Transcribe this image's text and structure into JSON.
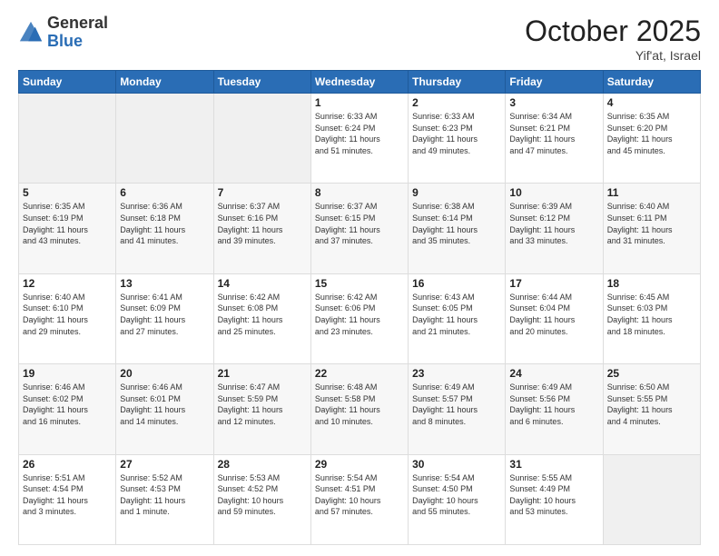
{
  "header": {
    "logo_general": "General",
    "logo_blue": "Blue",
    "month": "October 2025",
    "location": "Yif'at, Israel"
  },
  "weekdays": [
    "Sunday",
    "Monday",
    "Tuesday",
    "Wednesday",
    "Thursday",
    "Friday",
    "Saturday"
  ],
  "weeks": [
    [
      {
        "day": "",
        "info": ""
      },
      {
        "day": "",
        "info": ""
      },
      {
        "day": "",
        "info": ""
      },
      {
        "day": "1",
        "info": "Sunrise: 6:33 AM\nSunset: 6:24 PM\nDaylight: 11 hours\nand 51 minutes."
      },
      {
        "day": "2",
        "info": "Sunrise: 6:33 AM\nSunset: 6:23 PM\nDaylight: 11 hours\nand 49 minutes."
      },
      {
        "day": "3",
        "info": "Sunrise: 6:34 AM\nSunset: 6:21 PM\nDaylight: 11 hours\nand 47 minutes."
      },
      {
        "day": "4",
        "info": "Sunrise: 6:35 AM\nSunset: 6:20 PM\nDaylight: 11 hours\nand 45 minutes."
      }
    ],
    [
      {
        "day": "5",
        "info": "Sunrise: 6:35 AM\nSunset: 6:19 PM\nDaylight: 11 hours\nand 43 minutes."
      },
      {
        "day": "6",
        "info": "Sunrise: 6:36 AM\nSunset: 6:18 PM\nDaylight: 11 hours\nand 41 minutes."
      },
      {
        "day": "7",
        "info": "Sunrise: 6:37 AM\nSunset: 6:16 PM\nDaylight: 11 hours\nand 39 minutes."
      },
      {
        "day": "8",
        "info": "Sunrise: 6:37 AM\nSunset: 6:15 PM\nDaylight: 11 hours\nand 37 minutes."
      },
      {
        "day": "9",
        "info": "Sunrise: 6:38 AM\nSunset: 6:14 PM\nDaylight: 11 hours\nand 35 minutes."
      },
      {
        "day": "10",
        "info": "Sunrise: 6:39 AM\nSunset: 6:12 PM\nDaylight: 11 hours\nand 33 minutes."
      },
      {
        "day": "11",
        "info": "Sunrise: 6:40 AM\nSunset: 6:11 PM\nDaylight: 11 hours\nand 31 minutes."
      }
    ],
    [
      {
        "day": "12",
        "info": "Sunrise: 6:40 AM\nSunset: 6:10 PM\nDaylight: 11 hours\nand 29 minutes."
      },
      {
        "day": "13",
        "info": "Sunrise: 6:41 AM\nSunset: 6:09 PM\nDaylight: 11 hours\nand 27 minutes."
      },
      {
        "day": "14",
        "info": "Sunrise: 6:42 AM\nSunset: 6:08 PM\nDaylight: 11 hours\nand 25 minutes."
      },
      {
        "day": "15",
        "info": "Sunrise: 6:42 AM\nSunset: 6:06 PM\nDaylight: 11 hours\nand 23 minutes."
      },
      {
        "day": "16",
        "info": "Sunrise: 6:43 AM\nSunset: 6:05 PM\nDaylight: 11 hours\nand 21 minutes."
      },
      {
        "day": "17",
        "info": "Sunrise: 6:44 AM\nSunset: 6:04 PM\nDaylight: 11 hours\nand 20 minutes."
      },
      {
        "day": "18",
        "info": "Sunrise: 6:45 AM\nSunset: 6:03 PM\nDaylight: 11 hours\nand 18 minutes."
      }
    ],
    [
      {
        "day": "19",
        "info": "Sunrise: 6:46 AM\nSunset: 6:02 PM\nDaylight: 11 hours\nand 16 minutes."
      },
      {
        "day": "20",
        "info": "Sunrise: 6:46 AM\nSunset: 6:01 PM\nDaylight: 11 hours\nand 14 minutes."
      },
      {
        "day": "21",
        "info": "Sunrise: 6:47 AM\nSunset: 5:59 PM\nDaylight: 11 hours\nand 12 minutes."
      },
      {
        "day": "22",
        "info": "Sunrise: 6:48 AM\nSunset: 5:58 PM\nDaylight: 11 hours\nand 10 minutes."
      },
      {
        "day": "23",
        "info": "Sunrise: 6:49 AM\nSunset: 5:57 PM\nDaylight: 11 hours\nand 8 minutes."
      },
      {
        "day": "24",
        "info": "Sunrise: 6:49 AM\nSunset: 5:56 PM\nDaylight: 11 hours\nand 6 minutes."
      },
      {
        "day": "25",
        "info": "Sunrise: 6:50 AM\nSunset: 5:55 PM\nDaylight: 11 hours\nand 4 minutes."
      }
    ],
    [
      {
        "day": "26",
        "info": "Sunrise: 5:51 AM\nSunset: 4:54 PM\nDaylight: 11 hours\nand 3 minutes."
      },
      {
        "day": "27",
        "info": "Sunrise: 5:52 AM\nSunset: 4:53 PM\nDaylight: 11 hours\nand 1 minute."
      },
      {
        "day": "28",
        "info": "Sunrise: 5:53 AM\nSunset: 4:52 PM\nDaylight: 10 hours\nand 59 minutes."
      },
      {
        "day": "29",
        "info": "Sunrise: 5:54 AM\nSunset: 4:51 PM\nDaylight: 10 hours\nand 57 minutes."
      },
      {
        "day": "30",
        "info": "Sunrise: 5:54 AM\nSunset: 4:50 PM\nDaylight: 10 hours\nand 55 minutes."
      },
      {
        "day": "31",
        "info": "Sunrise: 5:55 AM\nSunset: 4:49 PM\nDaylight: 10 hours\nand 53 minutes."
      },
      {
        "day": "",
        "info": ""
      }
    ]
  ]
}
